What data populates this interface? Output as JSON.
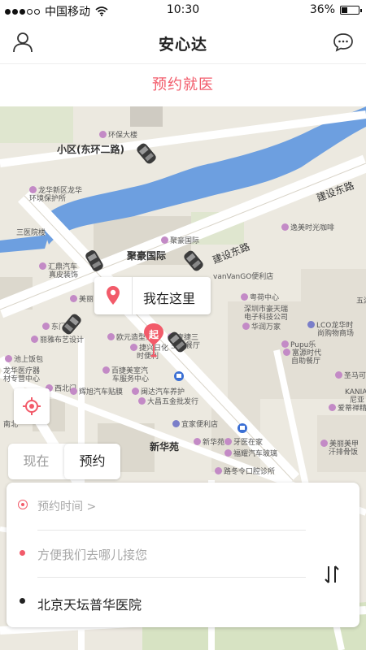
{
  "status_bar": {
    "carrier": "中国移动",
    "time": "10:30",
    "battery_percent": "36%",
    "battery_level": 0.36
  },
  "nav": {
    "title": "安心达"
  },
  "sub_header": {
    "label": "预约就医"
  },
  "map": {
    "labels": {
      "huanbao": "环保大楼",
      "xiaoqu": "小区(东环二路)",
      "longhua_env": "龙华新区龙华",
      "longhua_env2": "环境保护所",
      "jianshe_donglu_1": "建设东路",
      "jianshe_donglu_2": "建设东路",
      "sanyi": "三医院楼",
      "juhao_intl": "聚豪国际",
      "juhao_intl_poi": "聚豪国际",
      "yimei": "逸美时光咖啡",
      "huiding_qiche": "汇鼎汽车",
      "huiding_qiche2": "真皮装饰",
      "meili": "美丽",
      "vanvango": "vanVanGO便利店",
      "yuehang": "粤荷中心",
      "shenzhen_tech": "深圳市豪天瑞",
      "shenzhen_tech2": "电子科技公司",
      "huarun": "华润万家",
      "wuhu": "五湖",
      "lco": "LCO龙华时",
      "lco2": "尚购物商场",
      "east_gate": "东门",
      "xinli": "丽雅布艺设计",
      "ou_yuan": "欧元造型设计",
      "yiji_lou": "壹捷三",
      "yiji_lou2": "主题餐厅",
      "pupu": "Pupu乐",
      "fumo": "富源时代",
      "fumo2": "自助餐厅",
      "ji_yuan": "池上饭包",
      "longhua_hosp": "龙华医疗器",
      "longhua_hosp2": "材专营中心",
      "jianxing": "捷兴日化",
      "jianxing2": "时便利",
      "baidu_car": "百捷美室汽",
      "baidu_car2": "车服务中心",
      "xigong": "西北门",
      "huiwei": "辉旭汽车贴膜",
      "xinda": "闽达汽车养护",
      "dagao": "大昌五金批发行",
      "jima": "圣马可",
      "kania": "KANIA卡",
      "kania2": "尼亚",
      "aidi": "爱蒂禅精",
      "yiji_hotel": "宜家便利店",
      "xinhuayuan": "新华苑",
      "xinhuayuan_poi": "新华苑",
      "yaxi": "牙医在家",
      "fuxing": "福耀汽车玻璃",
      "meilan": "美丽美甲",
      "meilan2": "汗排骨饭",
      "luzhong": "路冬令口腔诊所",
      "nanbei": "南北"
    }
  },
  "here_bubble": {
    "label": "我在这里"
  },
  "start_marker": {
    "label": "起"
  },
  "mode_tabs": {
    "now_label": "现在",
    "book_label": "预约"
  },
  "booking": {
    "time_label": "预约时间 >",
    "pickup_placeholder": "方便我们去哪儿接您",
    "destination": "北京天坛普华医院"
  },
  "colors": {
    "accent": "#f25b6a",
    "water": "#6d9fe0",
    "road": "#ffffff",
    "block": "#dedad1",
    "green": "#d7e3c3"
  }
}
